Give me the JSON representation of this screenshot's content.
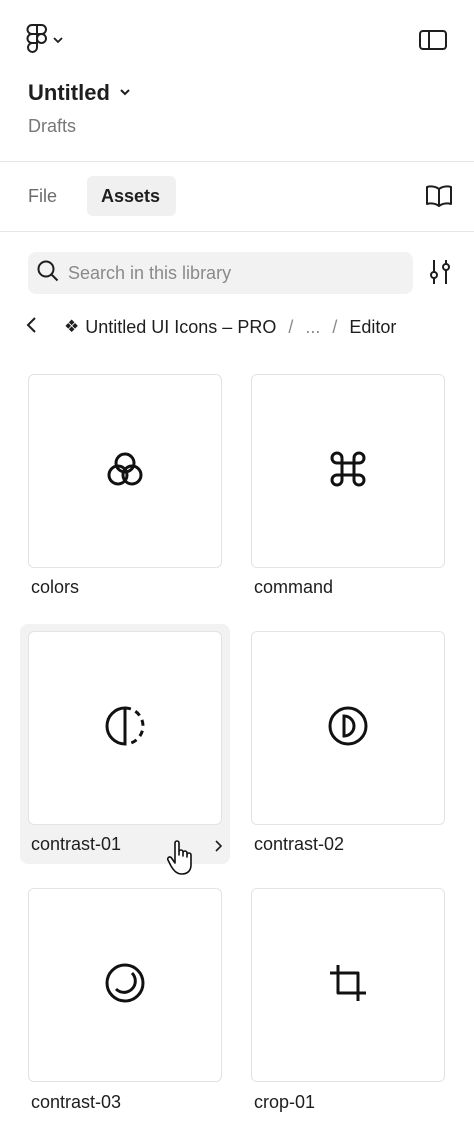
{
  "header": {
    "title": "Untitled",
    "subtitle": "Drafts"
  },
  "tabs": [
    {
      "label": "File",
      "active": false
    },
    {
      "label": "Assets",
      "active": true
    }
  ],
  "search": {
    "placeholder": "Search in this library"
  },
  "breadcrumb": {
    "component_glyph": "❖",
    "library": "Untitled UI Icons – PRO",
    "separator": "/",
    "ellipsis": "...",
    "current": "Editor"
  },
  "assets": [
    {
      "label": "colors",
      "icon": "colors-icon"
    },
    {
      "label": "command",
      "icon": "command-icon"
    },
    {
      "label": "contrast-01",
      "icon": "contrast-01-icon",
      "hovered": true
    },
    {
      "label": "contrast-02",
      "icon": "contrast-02-icon"
    },
    {
      "label": "contrast-03",
      "icon": "contrast-03-icon"
    },
    {
      "label": "crop-01",
      "icon": "crop-01-icon"
    }
  ],
  "colors": {
    "text": "#1e1e1e",
    "muted": "#777777",
    "active_tab_bg": "#f0f0f0",
    "card_border": "#e3e3e3"
  }
}
